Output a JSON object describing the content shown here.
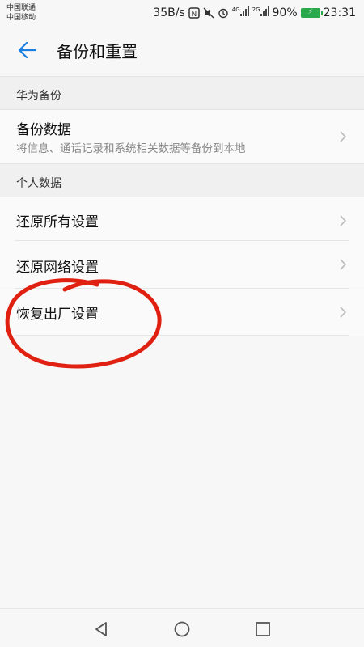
{
  "status_bar": {
    "carrier1": "中国联通",
    "carrier2": "中国移动",
    "speed": "35B/s",
    "net1": "4G",
    "net2": "2G",
    "battery_percent": "90%",
    "time": "23:31",
    "icons": [
      "nfc-icon",
      "mute-icon",
      "alarm-icon",
      "signal-icon",
      "battery-charging-icon"
    ],
    "battery_color": "#2aa84a"
  },
  "header": {
    "title": "备份和重置",
    "back_icon": "arrow-left-icon",
    "accent_color": "#1a7fe0"
  },
  "sections": [
    {
      "header": "华为备份",
      "items": [
        {
          "title": "备份数据",
          "subtitle": "将信息、通话记录和系统相关数据等备份到本地"
        }
      ]
    },
    {
      "header": "个人数据",
      "items": [
        {
          "title": "还原所有设置"
        },
        {
          "title": "还原网络设置"
        },
        {
          "title": "恢复出厂设置"
        }
      ]
    }
  ],
  "annotation": {
    "shape": "hand-drawn-circle",
    "color": "#e02010",
    "target": "恢复出厂设置"
  },
  "nav_bar": {
    "buttons": [
      "back-triangle-icon",
      "home-circle-icon",
      "recents-square-icon"
    ]
  }
}
